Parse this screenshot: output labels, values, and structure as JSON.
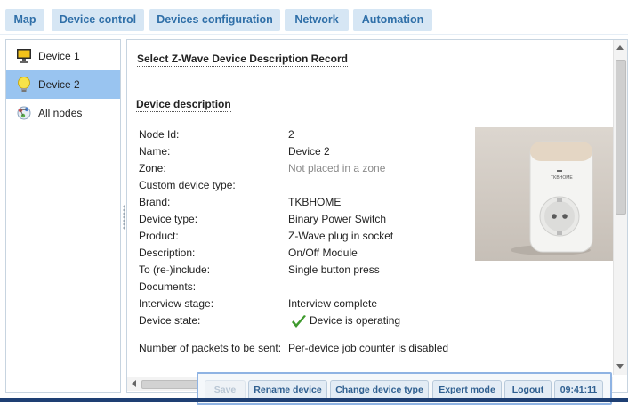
{
  "nav_tabs": [
    "Map",
    "Device control",
    "Devices configuration",
    "Network",
    "Automation"
  ],
  "sidebar": {
    "items": [
      {
        "label": "Device 1",
        "icon": "monitor-icon",
        "selected": false
      },
      {
        "label": "Device 2",
        "icon": "lightbulb-icon",
        "selected": true
      },
      {
        "label": "All nodes",
        "icon": "network-nodes-icon",
        "selected": false
      }
    ]
  },
  "main": {
    "record_title": "Select Z-Wave Device Description Record",
    "section_title": "Device description",
    "rows": [
      {
        "label": "Node Id:",
        "value": "2"
      },
      {
        "label": "Name:",
        "value": "Device 2"
      },
      {
        "label": "Zone:",
        "value": "Not placed in a zone",
        "muted": true
      },
      {
        "label": "Custom device type:",
        "value": ""
      },
      {
        "label": "Brand:",
        "value": "TKBHOME"
      },
      {
        "label": "Device type:",
        "value": "Binary Power Switch"
      },
      {
        "label": "Product:",
        "value": "Z-Wave plug in socket"
      },
      {
        "label": "Description:",
        "value": "On/Off Module"
      },
      {
        "label": "To (re-)include:",
        "value": "Single button press"
      },
      {
        "label": "Documents:",
        "value": ""
      },
      {
        "label": "Interview stage:",
        "value": "Interview complete"
      },
      {
        "label": "Device state:",
        "value": "Device is operating",
        "icon": "checkmark-icon"
      },
      {
        "label": "Number of packets to be sent:",
        "value": "Per-device job counter is disabled"
      }
    ],
    "device_image_brand": "TKBHOME"
  },
  "toolbar": {
    "save": "Save",
    "rename": "Rename device",
    "change_type": "Change device type",
    "expert": "Expert mode",
    "logout": "Logout",
    "clock": "09:41:11"
  },
  "colors": {
    "tab_bg": "#d6e6f4",
    "tab_text": "#2f6fa8",
    "selected_item": "#99c4f0",
    "toolbar_border": "#8fb3e3",
    "check_green": "#3f9a2e"
  }
}
